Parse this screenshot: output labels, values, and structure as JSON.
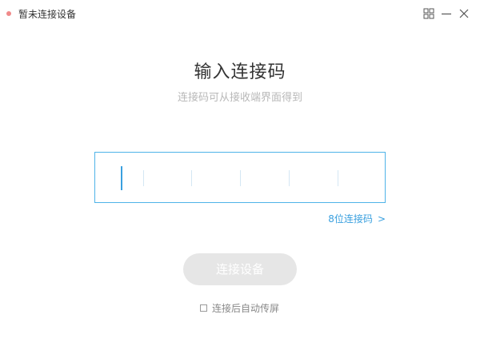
{
  "window": {
    "title": "暂未连接设备",
    "status_color": "#f08a8a",
    "icons": [
      "grid-icon",
      "minimize-icon",
      "close-icon"
    ]
  },
  "main": {
    "title": "输入连接码",
    "subtitle": "连接码可从接收端界面得到"
  },
  "code_input": {
    "value": "",
    "slots": 6,
    "border_color": "#4fb3e8"
  },
  "code_toggle": {
    "label": "8位连接码",
    "chevron": ">"
  },
  "connect_button": {
    "label": "连接设备",
    "enabled": false
  },
  "auto_cast": {
    "label": "连接后自动传屏",
    "checked": false
  }
}
